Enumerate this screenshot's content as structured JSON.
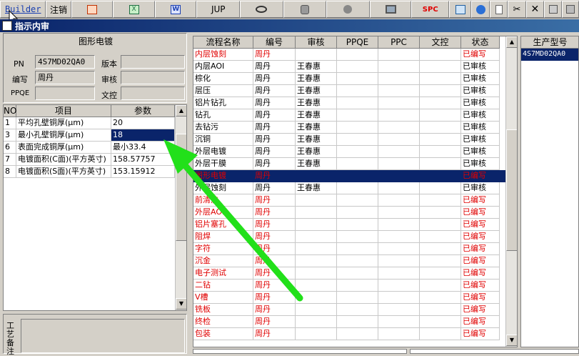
{
  "toolbar": {
    "builder": "Builder",
    "logout": "注销",
    "jup": "JUP",
    "spc": "SPC"
  },
  "window": {
    "title": "指示内审"
  },
  "info": {
    "section_title": "图形电镀",
    "pn_label": "PN",
    "pn_value": "4S7MD02QA0",
    "version_label": "版本",
    "version_value": "",
    "writer_label": "编写",
    "writer_value": "周丹",
    "review_label": "审核",
    "review_value": "",
    "ppqe_label": "PPQE",
    "ppqe_value": "",
    "doc_label": "文控",
    "doc_value": ""
  },
  "params": {
    "headers": [
      "NO",
      "项目",
      "参数"
    ],
    "rows": [
      {
        "no": "1",
        "item": "平均孔壁铜厚(μm)",
        "value": "20"
      },
      {
        "no": "3",
        "item": "最小孔壁铜厚(μm)",
        "value": "18"
      },
      {
        "no": "6",
        "item": "表面完成铜厚(μm)",
        "value": "最小33.4"
      },
      {
        "no": "7",
        "item": "电镀面积(C面)(平方英寸)",
        "value": "158.57757"
      },
      {
        "no": "8",
        "item": "电镀面积(S面)(平方英寸)",
        "value": "153.15912"
      }
    ]
  },
  "process_label": "工艺备注",
  "flow": {
    "headers": [
      "流程名称",
      "编号",
      "审核",
      "PPQE",
      "PPC",
      "文控",
      "状态"
    ],
    "rows": [
      {
        "name": "内层蚀刻",
        "writer": "周丹",
        "reviewer": "",
        "status": "已编写",
        "red": true
      },
      {
        "name": "内层AOI",
        "writer": "周丹",
        "reviewer": "王春惠",
        "status": "已审核",
        "red": false
      },
      {
        "name": "棕化",
        "writer": "周丹",
        "reviewer": "王春惠",
        "status": "已审核",
        "red": false
      },
      {
        "name": "层压",
        "writer": "周丹",
        "reviewer": "王春惠",
        "status": "已审核",
        "red": false
      },
      {
        "name": "铝片钻孔",
        "writer": "周丹",
        "reviewer": "王春惠",
        "status": "已审核",
        "red": false
      },
      {
        "name": "钻孔",
        "writer": "周丹",
        "reviewer": "王春惠",
        "status": "已审核",
        "red": false
      },
      {
        "name": "去钻污",
        "writer": "周丹",
        "reviewer": "王春惠",
        "status": "已审核",
        "red": false
      },
      {
        "name": "沉铜",
        "writer": "周丹",
        "reviewer": "王春惠",
        "status": "已审核",
        "red": false
      },
      {
        "name": "外层电镀",
        "writer": "周丹",
        "reviewer": "王春惠",
        "status": "已审核",
        "red": false
      },
      {
        "name": "外层干膜",
        "writer": "周丹",
        "reviewer": "王春惠",
        "status": "已审核",
        "red": false
      },
      {
        "name": "图形电镀",
        "writer": "周丹",
        "reviewer": "",
        "status": "已编写",
        "red": true,
        "selected": true
      },
      {
        "name": "外层蚀刻",
        "writer": "周丹",
        "reviewer": "王春惠",
        "status": "已审核",
        "red": false
      },
      {
        "name": "前清洗",
        "writer": "周丹",
        "reviewer": "",
        "status": "已编写",
        "red": true
      },
      {
        "name": "外层AOI",
        "writer": "周丹",
        "reviewer": "",
        "status": "已编写",
        "red": true
      },
      {
        "name": "铝片塞孔",
        "writer": "周丹",
        "reviewer": "",
        "status": "已编写",
        "red": true
      },
      {
        "name": "阻焊",
        "writer": "周丹",
        "reviewer": "",
        "status": "已编写",
        "red": true
      },
      {
        "name": "字符",
        "writer": "周丹",
        "reviewer": "",
        "status": "已编写",
        "red": true
      },
      {
        "name": "沉金",
        "writer": "周丹",
        "reviewer": "",
        "status": "已编写",
        "red": true
      },
      {
        "name": "电子测试",
        "writer": "周丹",
        "reviewer": "",
        "status": "已编写",
        "red": true
      },
      {
        "name": "二钻",
        "writer": "周丹",
        "reviewer": "",
        "status": "已编写",
        "red": true
      },
      {
        "name": "V槽",
        "writer": "周丹",
        "reviewer": "",
        "status": "已编写",
        "red": true
      },
      {
        "name": "铣板",
        "writer": "周丹",
        "reviewer": "",
        "status": "已编写",
        "red": true
      },
      {
        "name": "终检",
        "writer": "周丹",
        "reviewer": "",
        "status": "已编写",
        "red": true
      },
      {
        "name": "包装",
        "writer": "周丹",
        "reviewer": "",
        "status": "已编写",
        "red": true
      }
    ]
  },
  "model": {
    "header": "生产型号",
    "rows": [
      "4S7MD02QA0"
    ]
  }
}
